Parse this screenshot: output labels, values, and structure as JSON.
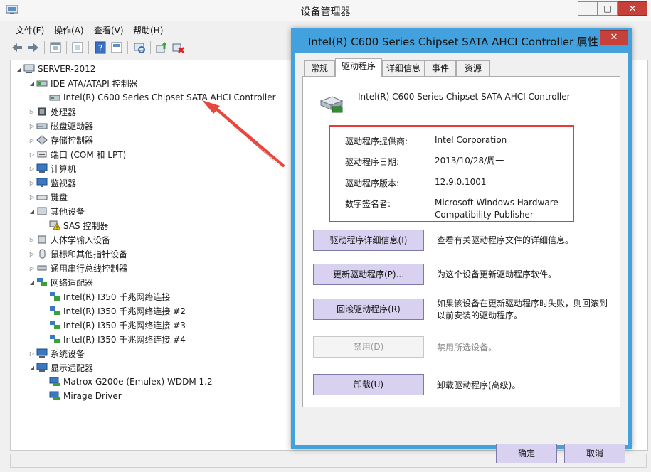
{
  "window": {
    "title": "设备管理器",
    "min_label": "–",
    "max_label": "□",
    "close_label": "✕"
  },
  "menu": [
    "文件(F)",
    "操作(A)",
    "查看(V)",
    "帮助(H)"
  ],
  "toolbar_icons": [
    "back-icon",
    "forward-icon",
    "properties-sheet-icon",
    "help-sheet-icon",
    "help-icon",
    "console-icon",
    "scan-hardware-icon",
    "update-driver-icon",
    "uninstall-icon"
  ],
  "tree": {
    "root": "SERVER-2012",
    "ide": "IDE ATA/ATAPI 控制器",
    "ide_child": "Intel(R) C600 Series Chipset SATA AHCI Controller",
    "processor": "处理器",
    "disk": "磁盘驱动器",
    "storage": "存储控制器",
    "ports": "端口 (COM 和 LPT)",
    "computer": "计算机",
    "monitor": "监视器",
    "keyboard": "键盘",
    "other": "其他设备",
    "sas": "SAS 控制器",
    "hid": "人体学输入设备",
    "mouse": "鼠标和其他指针设备",
    "usb": "通用串行总线控制器",
    "network": "网络适配器",
    "nic1": "Intel(R) I350 千兆网络连接",
    "nic2": "Intel(R) I350 千兆网络连接 #2",
    "nic3": "Intel(R) I350 千兆网络连接 #3",
    "nic4": "Intel(R) I350 千兆网络连接 #4",
    "system": "系统设备",
    "display": "显示适配器",
    "gpu": "Matrox G200e (Emulex) WDDM 1.2",
    "mirage": "Mirage Driver"
  },
  "dialog": {
    "title": "Intel(R) C600 Series Chipset SATA AHCI Controller 属性",
    "close_label": "✕",
    "tabs": [
      "常规",
      "驱动程序",
      "详细信息",
      "事件",
      "资源"
    ],
    "device_name": "Intel(R) C600 Series Chipset SATA AHCI Controller",
    "provider_label": "驱动程序提供商:",
    "provider_value": "Intel Corporation",
    "date_label": "驱动程序日期:",
    "date_value": "2013/10/28/周一",
    "version_label": "驱动程序版本:",
    "version_value": "12.9.0.1001",
    "signer_label": "数字签名者:",
    "signer_value": "Microsoft Windows Hardware Compatibility Publisher",
    "btn_details": "驱动程序详细信息(I)",
    "desc_details": "查看有关驱动程序文件的详细信息。",
    "btn_update": "更新驱动程序(P)...",
    "desc_update": "为这个设备更新驱动程序软件。",
    "btn_rollback": "回滚驱动程序(R)",
    "desc_rollback": "如果该设备在更新驱动程序时失败，则回滚到以前安装的驱动程序。",
    "btn_disable": "禁用(D)",
    "desc_disable": "禁用所选设备。",
    "btn_uninstall": "卸载(U)",
    "desc_uninstall": "卸载驱动程序(高级)。",
    "ok": "确定",
    "cancel": "取消"
  },
  "colors": {
    "dialog_frame": "#43a2dd",
    "highlight_box": "#e53b3b",
    "arrow": "#e8473e",
    "button_face": "#d8d2f0"
  }
}
